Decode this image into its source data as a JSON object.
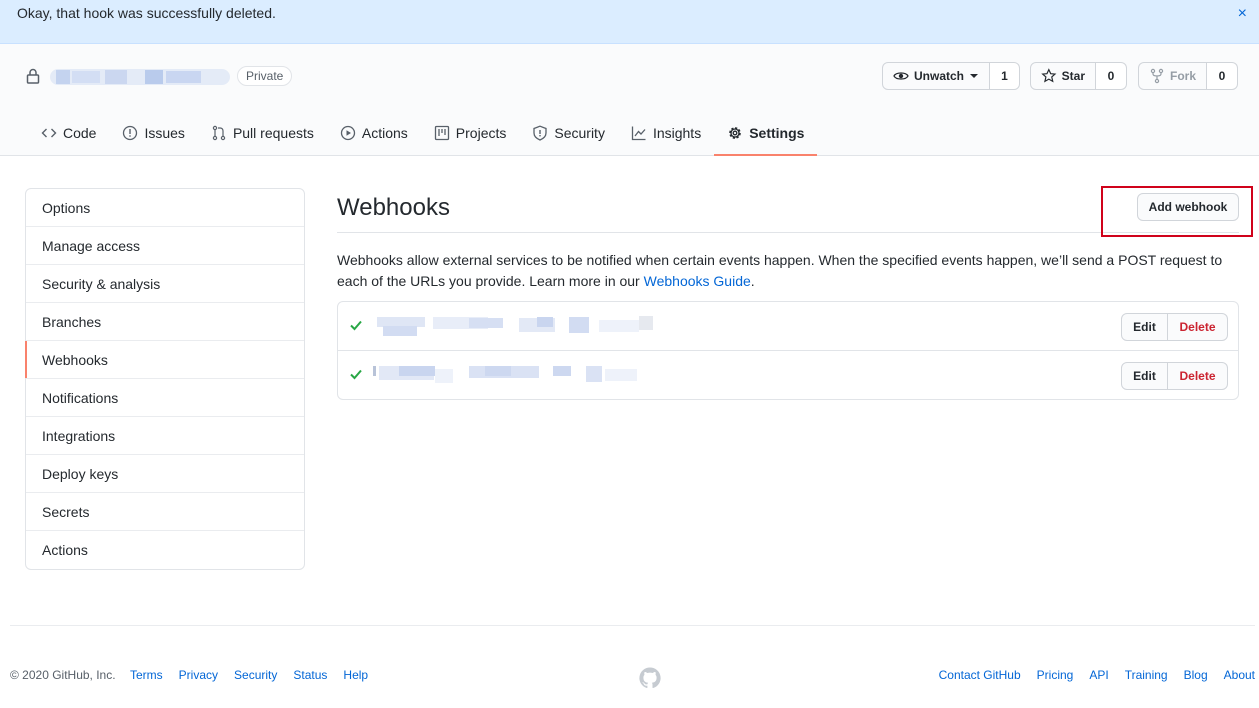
{
  "flash": {
    "message": "Okay, that hook was successfully deleted.",
    "close": "×"
  },
  "repo": {
    "badge": "Private"
  },
  "actions": {
    "watch": {
      "label": "Unwatch",
      "count": "1"
    },
    "star": {
      "label": "Star",
      "count": "0"
    },
    "fork": {
      "label": "Fork",
      "count": "0"
    }
  },
  "tabs": [
    {
      "label": "Code",
      "icon": "code-icon"
    },
    {
      "label": "Issues",
      "icon": "issue-icon"
    },
    {
      "label": "Pull requests",
      "icon": "pull-request-icon"
    },
    {
      "label": "Actions",
      "icon": "play-icon"
    },
    {
      "label": "Projects",
      "icon": "project-icon"
    },
    {
      "label": "Security",
      "icon": "shield-icon"
    },
    {
      "label": "Insights",
      "icon": "graph-icon"
    },
    {
      "label": "Settings",
      "icon": "gear-icon",
      "selected": true
    }
  ],
  "sidebar": {
    "items": [
      {
        "label": "Options"
      },
      {
        "label": "Manage access"
      },
      {
        "label": "Security & analysis"
      },
      {
        "label": "Branches"
      },
      {
        "label": "Webhooks",
        "selected": true
      },
      {
        "label": "Notifications"
      },
      {
        "label": "Integrations"
      },
      {
        "label": "Deploy keys"
      },
      {
        "label": "Secrets"
      },
      {
        "label": "Actions"
      }
    ]
  },
  "main": {
    "title": "Webhooks",
    "add_button": "Add webhook",
    "description_before": "Webhooks allow external services to be notified when certain events happen. When the specified events happen, we’ll send a POST request to each of the URLs you provide. Learn more in our ",
    "description_link": "Webhooks Guide",
    "description_after": ".",
    "hooks": [
      {
        "edit": "Edit",
        "delete": "Delete"
      },
      {
        "edit": "Edit",
        "delete": "Delete"
      }
    ]
  },
  "footer": {
    "copyright": "© 2020 GitHub, Inc.",
    "left_links": [
      "Terms",
      "Privacy",
      "Security",
      "Status",
      "Help"
    ],
    "right_links": [
      "Contact GitHub",
      "Pricing",
      "API",
      "Training",
      "Blog",
      "About"
    ]
  },
  "colors": {
    "accent": "#f9826c",
    "link": "#0366d6",
    "danger": "#cb2431",
    "success": "#28a745",
    "highlight_box": "#d0021b"
  }
}
